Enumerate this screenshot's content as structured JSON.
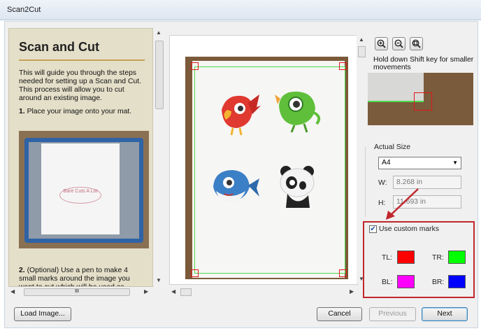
{
  "window": {
    "title": "Scan2Cut"
  },
  "guide": {
    "heading": "Scan and Cut",
    "intro": "This will guide you through the steps needed for setting up a Scan and Cut. This process will allow you to cut around an existing image.",
    "step1_number": "1.",
    "step1_text": "Place your image onto your mat.",
    "step2_number": "2.",
    "step2_text": "(Optional) Use a pen to make 4 small marks around the image you want to cut which will be used as",
    "photo_logo_text": "Bare Cuts A Lot"
  },
  "zoom": {
    "zoom_in_icon": "zoom-in-icon",
    "zoom_out_icon": "zoom-out-icon",
    "zoom_fit_icon": "zoom-fit-icon"
  },
  "hint": "Hold down Shift key for smaller movements",
  "size": {
    "label": "Actual Size",
    "selected": "A4",
    "width_label": "W:",
    "width_value": "8.268 in",
    "height_label": "H:",
    "height_value": "11.693 in"
  },
  "custom_marks": {
    "label": "Use custom marks",
    "checked": true,
    "tl_label": "TL:",
    "tr_label": "TR:",
    "bl_label": "BL:",
    "br_label": "BR:",
    "tl_color": "#ff0000",
    "tr_color": "#00ff00",
    "bl_color": "#ff00ff",
    "br_color": "#0000ff"
  },
  "scroll": {
    "h_thumb_text": "III"
  },
  "buttons": {
    "load": "Load Image...",
    "cancel": "Cancel",
    "previous": "Previous",
    "next": "Next"
  },
  "colors": {
    "mark_red": "#e01818",
    "border_green": "#4ddc4d",
    "highlight": "#c0272d"
  }
}
